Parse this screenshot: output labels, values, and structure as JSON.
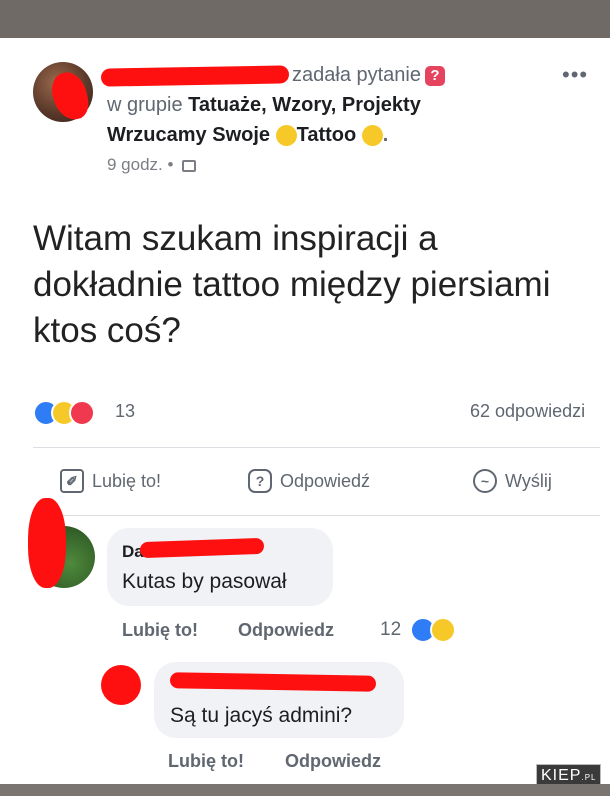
{
  "post": {
    "action_text": "zadała pytanie",
    "group_prefix": "w grupie",
    "group_line1": "Tatuaże, Wzory, Projekty",
    "group_line2a": "Wrzucamy Swoje",
    "group_line2b": "Tattoo",
    "question_icon": "?",
    "time": "9 godz.",
    "separator": "•",
    "more": "•••",
    "body": "Witam szukam inspiracji  a\ndokładnie tattoo między piersiami\nktos coś?",
    "reaction_count": "13",
    "answers": "62 odpowiedzi"
  },
  "actions": {
    "like": "Lubię to!",
    "answer": "Odpowiedź",
    "send": "Wyślij"
  },
  "comments": [
    {
      "name_visible": "Da",
      "text": "Kutas by pasował",
      "like": "Lubię to!",
      "reply": "Odpowiedz",
      "reaction_count": "12"
    },
    {
      "name_visible": "",
      "text": "Są tu jacyś admini?",
      "like": "Lubię to!",
      "reply": "Odpowiedz"
    }
  ],
  "watermark": {
    "main": "KIEP",
    "suffix": ".PL"
  },
  "colors": {
    "redaction": "#ff1010",
    "like_blue": "#2e7cf6",
    "love_red": "#f0384f",
    "haha_yellow": "#f7c928"
  },
  "icons": [
    "question-mark-icon",
    "upside-down-face-emoji-icon",
    "smiley-emoji-icon",
    "group-icon",
    "like-reaction-icon",
    "haha-reaction-icon",
    "love-reaction-icon",
    "thumbs-up-icon",
    "question-bubble-icon",
    "messenger-icon"
  ]
}
